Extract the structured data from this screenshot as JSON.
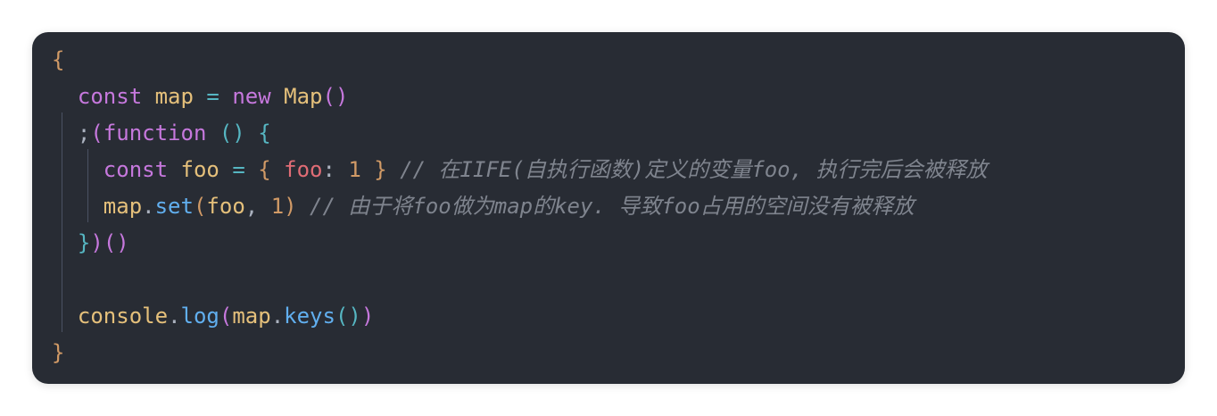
{
  "code": {
    "line1": {
      "open_brace": "{"
    },
    "line2": {
      "indent": "  ",
      "kw_const": "const",
      "var_map": "map",
      "op_eq": "=",
      "kw_new": "new",
      "class_map": "Map",
      "parens": "()"
    },
    "line3": {
      "indent": "  ",
      "semicolon": ";",
      "open_paren": "(",
      "kw_function": "function",
      "parens": "()",
      "open_brace": "{"
    },
    "line4": {
      "indent": "    ",
      "kw_const": "const",
      "var_foo": "foo",
      "op_eq": "=",
      "open_brace": "{",
      "prop_foo": "foo",
      "colon": ":",
      "num": "1",
      "close_brace": "}",
      "comment": "// 在IIFE(自执行函数)定义的变量foo, 执行完后会被释放"
    },
    "line5": {
      "indent": "    ",
      "var_map": "map",
      "dot": ".",
      "fn_set": "set",
      "open_paren": "(",
      "var_foo": "foo",
      "comma": ",",
      "num": "1",
      "close_paren": ")",
      "comment": "// 由于将foo做为map的key. 导致foo占用的空间没有被释放"
    },
    "line6": {
      "indent": "  ",
      "close_brace": "}",
      "close_paren": ")",
      "call_parens": "()"
    },
    "line7": {},
    "line8": {
      "indent": "  ",
      "var_console": "console",
      "dot1": ".",
      "fn_log": "log",
      "open_paren": "(",
      "var_map": "map",
      "dot2": ".",
      "fn_keys": "keys",
      "inner_parens": "()",
      "close_paren": ")"
    },
    "line9": {
      "close_brace": "}"
    }
  },
  "colors": {
    "background": "#282c34",
    "keyword": "#c678dd",
    "variable": "#e5c07b",
    "function": "#61afef",
    "property": "#e06c75",
    "number": "#d19a66",
    "operator": "#56b6c2",
    "comment": "#7f848e",
    "text": "#abb2bf"
  }
}
